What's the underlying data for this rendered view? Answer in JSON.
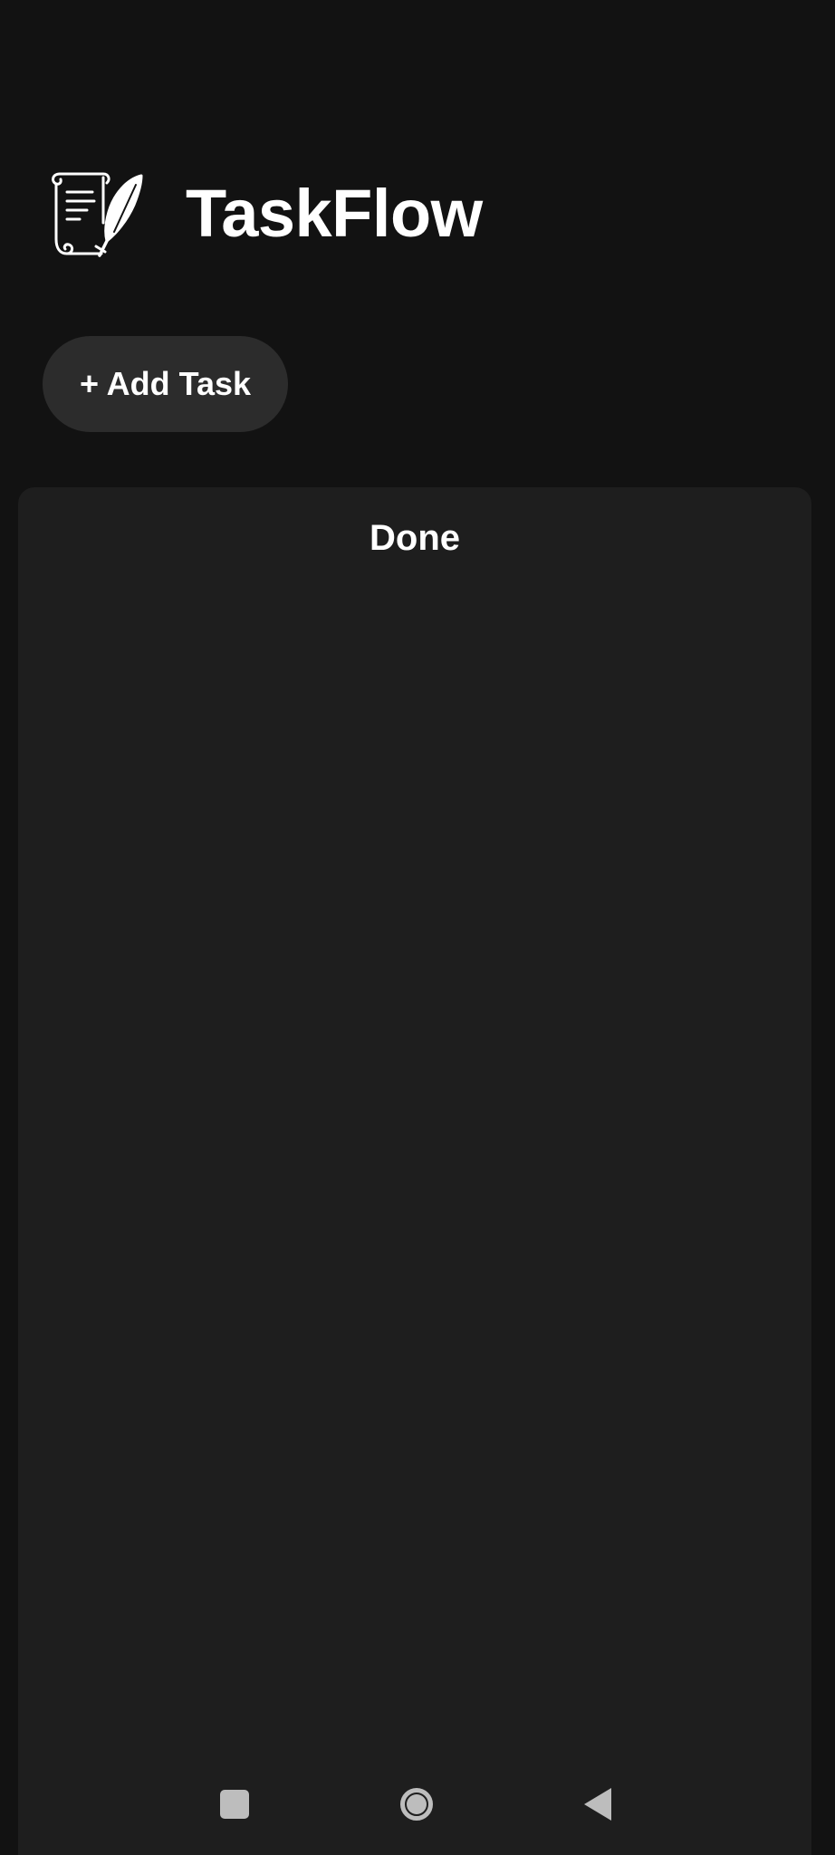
{
  "app": {
    "title": "TaskFlow",
    "logo_icon": "scroll-quill-icon"
  },
  "toolbar": {
    "add_task_label": "+ Add Task"
  },
  "board": {
    "columns": [
      {
        "title": "Done",
        "tasks": []
      }
    ]
  },
  "system_nav": {
    "recents_icon": "square-icon",
    "home_icon": "circle-icon",
    "back_icon": "triangle-back-icon"
  },
  "colors": {
    "background": "#121212",
    "column_background": "#1e1e1e",
    "button_background": "#2c2c2c",
    "text": "#ffffff",
    "nav_icons": "#bdbdbd"
  }
}
